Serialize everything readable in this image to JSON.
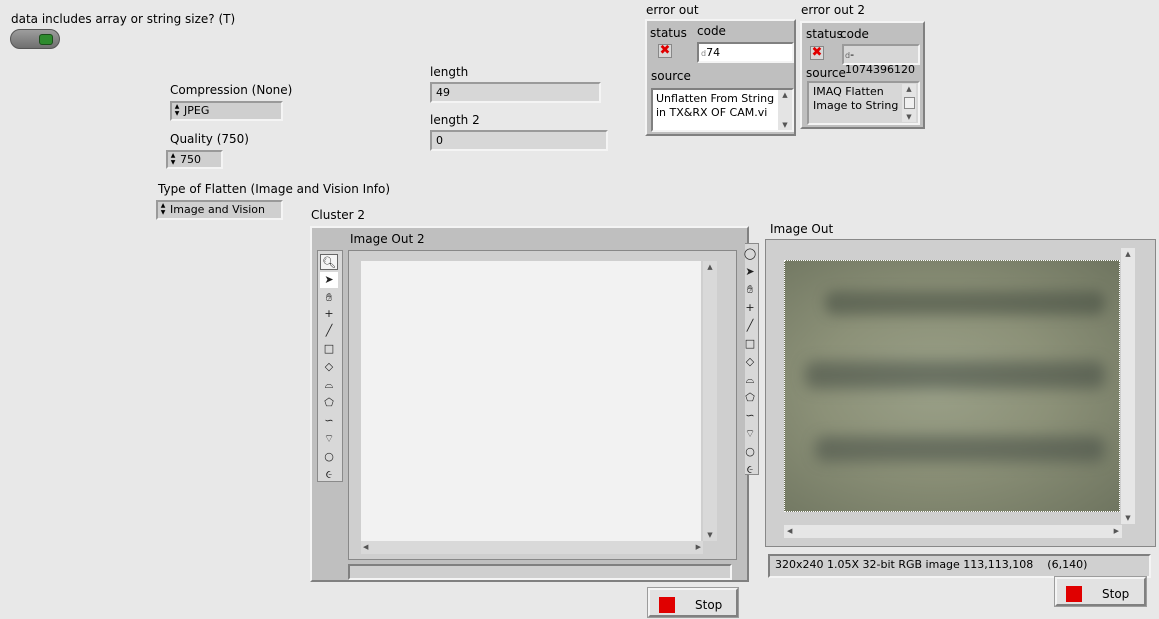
{
  "boolean": {
    "label": "data includes array or string size? (T)"
  },
  "compression": {
    "label": "Compression (None)",
    "value": "JPEG"
  },
  "quality": {
    "label": "Quality (750)",
    "value": "750"
  },
  "flatten_type": {
    "label": "Type of Flatten (Image and Vision Info)",
    "value": "Image and Vision"
  },
  "length": {
    "label": "length",
    "value": "49"
  },
  "length2": {
    "label": "length 2",
    "value": "0"
  },
  "error_out": {
    "title": "error out",
    "status_label": "status",
    "code_label": "code",
    "code_prefix": "d",
    "code_value": "74",
    "source_label": "source",
    "source_value": "Unflatten From String in TX&RX OF CAM.vi"
  },
  "error_out2": {
    "title": "error out 2",
    "status_label": "status",
    "code_label": "code",
    "code_prefix": "d",
    "code_value": "-1074396120",
    "source_label": "source",
    "source_value": "IMAQ Flatten Image to String"
  },
  "cluster2": {
    "label": "Cluster 2",
    "image_label": "Image Out 2"
  },
  "image_out": {
    "label": "Image Out",
    "status": "320x240 1.05X 32-bit RGB image 113,113,108",
    "coords": "(6,140)"
  },
  "stop1": {
    "label": "Stop"
  },
  "stop2": {
    "label": "Stop"
  },
  "icons": [
    "zoom-icon",
    "arrow-icon",
    "pan-icon",
    "point-icon",
    "line-icon",
    "rectangle-icon",
    "rotated-rect-icon",
    "annulus-icon",
    "polygon-icon",
    "freehand-icon",
    "broken-line-icon",
    "oval-icon",
    "free-region-icon"
  ],
  "colors": {
    "stop_square": "#e00000",
    "error_x": "#e00000",
    "boolean_led": "#2e8b2e"
  }
}
